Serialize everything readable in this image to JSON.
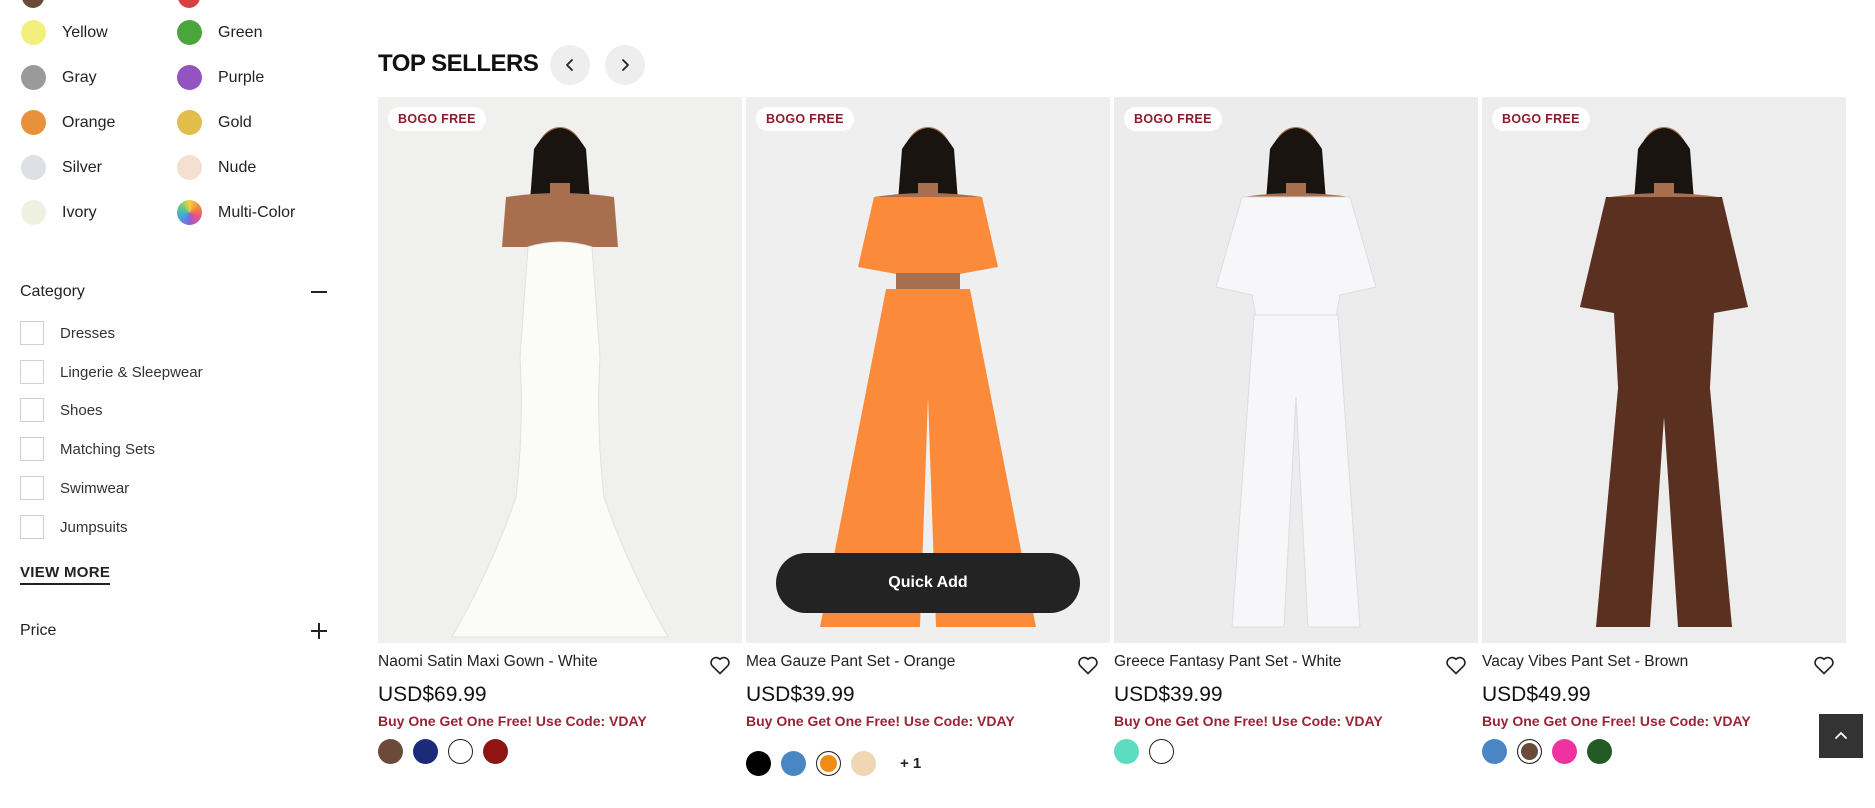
{
  "filters": {
    "colors": [
      {
        "label": "Yellow",
        "hex": "#f2ef7e"
      },
      {
        "label": "Green",
        "hex": "#4aa63c"
      },
      {
        "label": "Gray",
        "hex": "#9a9a9a"
      },
      {
        "label": "Purple",
        "hex": "#9354c2"
      },
      {
        "label": "Orange",
        "hex": "#e8913a"
      },
      {
        "label": "Gold",
        "hex": "#e1bd4c"
      },
      {
        "label": "Silver",
        "hex": "#dde1e6"
      },
      {
        "label": "Nude",
        "hex": "#f5dfd0"
      },
      {
        "label": "Ivory",
        "hex": "#eef1e0"
      },
      {
        "label": "Multi-Color",
        "hex": "multi"
      }
    ],
    "category": {
      "title": "Category",
      "items": [
        "Dresses",
        "Lingerie & Sleepwear",
        "Shoes",
        "Matching Sets",
        "Swimwear",
        "Jumpsuits"
      ],
      "view_more": "VIEW MORE"
    },
    "price": {
      "title": "Price"
    }
  },
  "section": {
    "title": "TOP SELLERS"
  },
  "products": [
    {
      "badge": "BOGO FREE",
      "name": "Naomi Satin Maxi Gown - White",
      "price": "USD$69.99",
      "promo": "Buy One Get One Free! Use Code: VDAY",
      "colors": [
        "#6b4a3a",
        "#1c2a7a",
        "#ffffff",
        "#8f1414"
      ],
      "selected_color": "",
      "more": "",
      "image_bg": "#f0f0ee",
      "garment": "#fbfbf8"
    },
    {
      "badge": "BOGO FREE",
      "name": "Mea Gauze Pant Set - Orange",
      "price": "USD$39.99",
      "promo": "Buy One Get One Free! Use Code: VDAY",
      "colors": [
        "#000000",
        "#4a85c4",
        "#f08c15",
        "#f0d6b5"
      ],
      "selected_color": "#f08c15",
      "more": "+ 1",
      "quick_add": "Quick Add",
      "image_bg": "#efefef",
      "garment": "#fb8b3a"
    },
    {
      "badge": "BOGO FREE",
      "name": "Greece Fantasy Pant Set - White",
      "price": "USD$39.99",
      "promo": "Buy One Get One Free! Use Code: VDAY",
      "colors": [
        "#5cdcc0",
        "#ffffff"
      ],
      "selected_color": "",
      "more": "",
      "image_bg": "#ececec",
      "garment": "#f7f7fa"
    },
    {
      "badge": "BOGO FREE",
      "name": "Vacay Vibes Pant Set - Brown",
      "price": "USD$49.99",
      "promo": "Buy One Get One Free! Use Code: VDAY",
      "colors": [
        "#4a85c4",
        "#6b4a3a",
        "#f032a0",
        "#235a26"
      ],
      "selected_color": "#6b4a3a",
      "more": "",
      "image_bg": "#ededed",
      "garment": "#5a3020"
    }
  ]
}
